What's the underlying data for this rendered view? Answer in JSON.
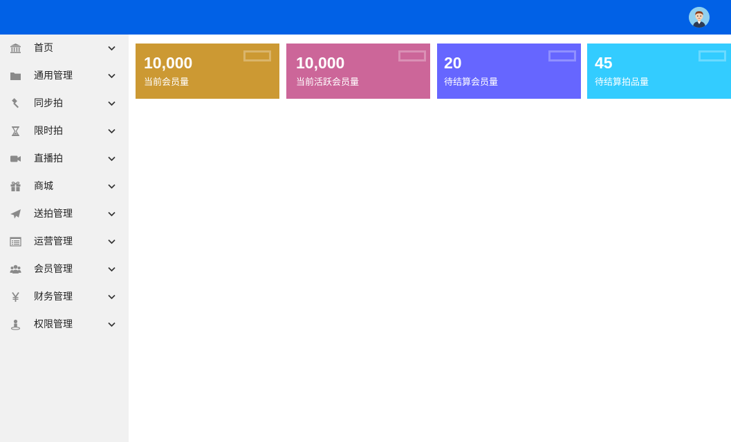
{
  "colors": {
    "topbar": "#0161e6",
    "sidebar_bg": "#f1f1f1",
    "icon": "#8a8a8a"
  },
  "user": {
    "avatar_icon": "user-avatar-icon"
  },
  "sidebar": {
    "items": [
      {
        "label": "首页",
        "icon": "bank-icon"
      },
      {
        "label": "通用管理",
        "icon": "folder-icon"
      },
      {
        "label": "同步拍",
        "icon": "gavel-icon"
      },
      {
        "label": "限时拍",
        "icon": "hourglass-icon"
      },
      {
        "label": "直播拍",
        "icon": "video-camera-icon"
      },
      {
        "label": "商城",
        "icon": "gift-icon"
      },
      {
        "label": "送拍管理",
        "icon": "paper-plane-icon"
      },
      {
        "label": "运营管理",
        "icon": "list-alt-icon"
      },
      {
        "label": "会员管理",
        "icon": "users-icon"
      },
      {
        "label": "财务管理",
        "icon": "yen-icon"
      },
      {
        "label": "权限管理",
        "icon": "user-lock-icon"
      }
    ]
  },
  "stats": [
    {
      "value": "10,000",
      "label": "当前会员量",
      "color": "#cc9933"
    },
    {
      "value": "10,000",
      "label": "当前活跃会员量",
      "color": "#cc6699"
    },
    {
      "value": "20",
      "label": "待结算会员量",
      "color": "#6666ff"
    },
    {
      "value": "45",
      "label": "待结算拍品量",
      "color": "#33ccff"
    }
  ]
}
